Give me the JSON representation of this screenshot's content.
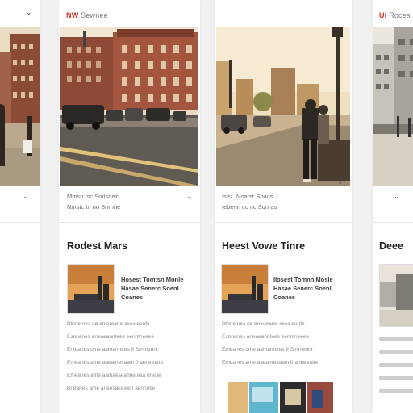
{
  "columns": {
    "b": {
      "tag_label": "NW",
      "tag_muted": "Sewnee",
      "caption_line1": "Mmsn tsc Smtsnez",
      "caption_line2": "Nmstc tn no Snrnne",
      "heading": "Rodest Mars",
      "thumb_title_1": "Hosest Tomtsn Monle",
      "thumb_title_2": "Hasae Senerc Soenl",
      "thumb_title_3": "Coanes",
      "text_lines": [
        "Btnnemes na aneoeane sees aonfe",
        "Esnnanes aneaeanntees eenntneees",
        "Enteanes ome aamannttes ff Smmennt",
        "Emeanes ame aaeamesaam 0 anneeatte",
        "Emeanes ame aamaeseannetesa nnetie",
        "Bneanes ame aneesaeawen aennetie"
      ]
    },
    "c": {
      "caption_line1": "Isez. Noarsr Soacs",
      "caption_line2": "Iebenn cc nc Sonras",
      "heading": "Heest Vowe Tinre",
      "thumb_title_1": "Ilosest Tomnn Mosle",
      "thumb_title_2": "Hasae Senerc Soenl",
      "thumb_title_3": "Coanes",
      "text_lines": [
        "Btnnemes na aneoeane sees aonfe",
        "Esnnanes aneaeanntees eenntneees",
        "Emeanes ome aamannttes ff Smmennt",
        "Emeanes ame aaeamesaam 0 anneeatte"
      ]
    },
    "d": {
      "tag_label": "UI",
      "tag_muted": "Roces",
      "heading": "Deee"
    }
  },
  "icons": {
    "chevron": "chevron-down-icon"
  }
}
